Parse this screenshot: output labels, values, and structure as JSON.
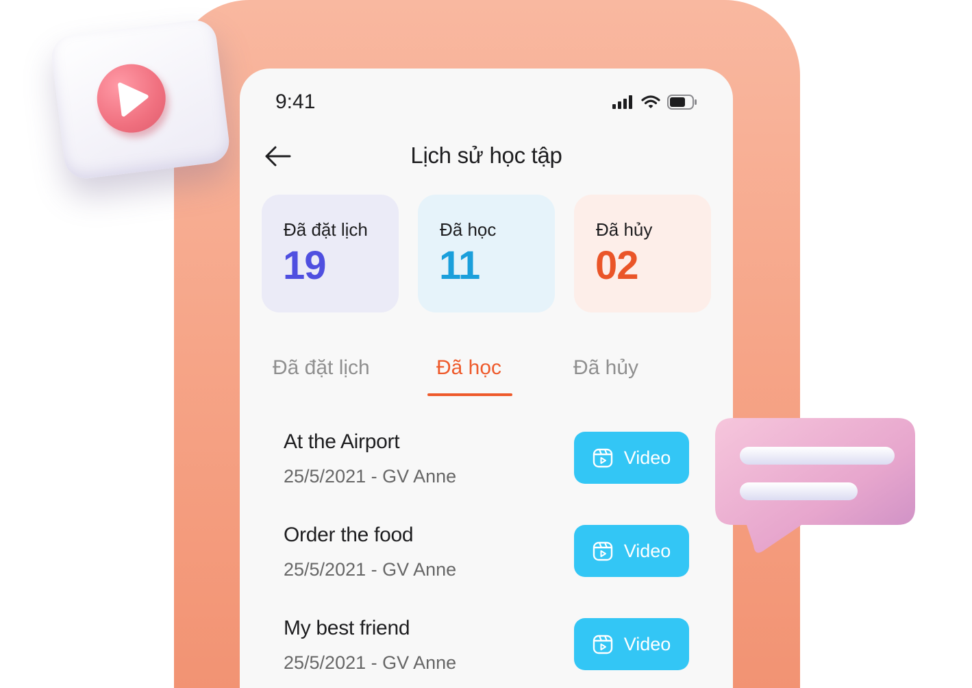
{
  "status_bar": {
    "time": "9:41"
  },
  "header": {
    "title": "Lịch sử học tập"
  },
  "stats": [
    {
      "label": "Đã đặt lịch",
      "value": "19",
      "color": "#4f4fe0",
      "bg": "#ebebf7"
    },
    {
      "label": "Đã học",
      "value": "11",
      "color": "#1b9fdb",
      "bg": "#e6f3fa"
    },
    {
      "label": "Đã hủy",
      "value": "02",
      "color": "#ea5528",
      "bg": "#fdeee9"
    }
  ],
  "tabs": [
    {
      "label": "Đã đặt lịch",
      "active": false
    },
    {
      "label": "Đã học",
      "active": true
    },
    {
      "label": "Đã hủy",
      "active": false
    }
  ],
  "lessons": [
    {
      "title": "At the Airport",
      "meta": "25/5/2021 - GV Anne",
      "button": "Video"
    },
    {
      "title": "Order the food",
      "meta": "25/5/2021 - GV Anne",
      "button": "Video"
    },
    {
      "title": "My best friend",
      "meta": "25/5/2021 - GV Anne",
      "button": "Video"
    }
  ],
  "colors": {
    "accent": "#ee5a2b",
    "video_button": "#33c6f5",
    "background_panel": "#f6a588"
  },
  "icons": [
    "play-icon",
    "chat-bubble-icon",
    "signal-icon",
    "wifi-icon",
    "battery-icon",
    "back-arrow-icon",
    "video-calendar-icon"
  ]
}
